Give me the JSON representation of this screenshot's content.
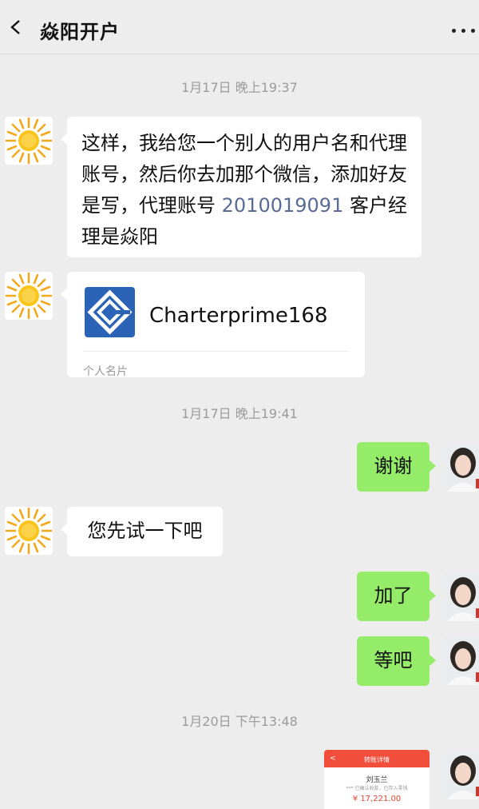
{
  "header": {
    "title": "焱阳开户"
  },
  "timestamps": [
    "1月17日 晚上19:37",
    "1月17日 晚上19:41",
    "1月20日 下午13:48"
  ],
  "messages": {
    "m1_part1": "这样，我给您一个别人的用户名和代理账号，然后你去加那个微信，添加好友是写，代理账号 ",
    "m1_link": "2010019091",
    "m1_part2": " 客户经理是焱阳",
    "card": {
      "name": "Charterprime168",
      "label": "个人名片"
    },
    "m3": "谢谢",
    "m4": "您先试一下吧",
    "m5": "加了",
    "m6": "等吧"
  },
  "transfer_thumb": {
    "title": "转账详情",
    "back": "<",
    "name": "刘玉兰",
    "sub": "*** 已确认收款，已存入零钱",
    "amount": "¥ 17,221.00"
  },
  "colors": {
    "own_bubble": "#95ec69",
    "link": "#576b95",
    "background": "#ededed"
  },
  "icons": [
    "back-icon",
    "more-icon",
    "sun-avatar-icon",
    "business-card-logo-icon",
    "person-avatar"
  ]
}
